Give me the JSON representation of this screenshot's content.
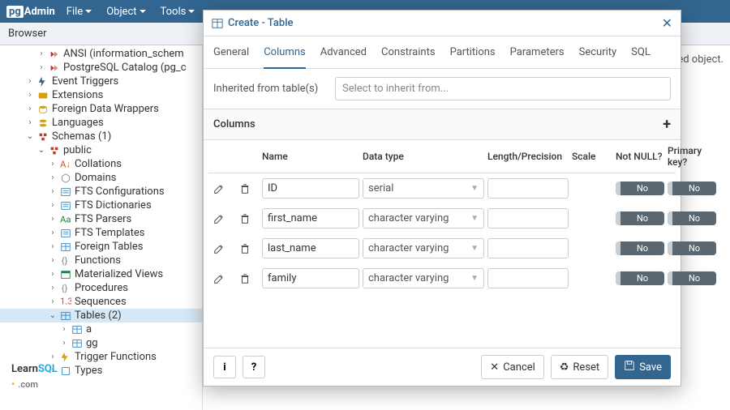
{
  "app": {
    "logo_prefix": "pg",
    "logo_rest": "Admin"
  },
  "menus": [
    "File",
    "Object",
    "Tools"
  ],
  "browser_label": "Browser",
  "content_hint": "ed object.",
  "tree": [
    {
      "indent": 3,
      "chev": ">",
      "icon": "cat",
      "color": "#c0392b",
      "label": "ANSI (information_schem"
    },
    {
      "indent": 3,
      "chev": ">",
      "icon": "cat",
      "color": "#c0392b",
      "label": "PostgreSQL Catalog (pg_c"
    },
    {
      "indent": 2,
      "chev": ">",
      "icon": "bolt",
      "color": "#326690",
      "label": "Event Triggers"
    },
    {
      "indent": 2,
      "chev": ">",
      "icon": "ext",
      "color": "#d6a20a",
      "label": "Extensions"
    },
    {
      "indent": 2,
      "chev": ">",
      "icon": "wrap",
      "color": "#d6a20a",
      "label": "Foreign Data Wrappers"
    },
    {
      "indent": 2,
      "chev": ">",
      "icon": "lang",
      "color": "#d6a20a",
      "label": "Languages"
    },
    {
      "indent": 2,
      "chev": "v",
      "icon": "schema",
      "color": "#c0392b",
      "label": "Schemas (1)"
    },
    {
      "indent": 3,
      "chev": "v",
      "icon": "schema",
      "color": "#c0392b",
      "label": "public"
    },
    {
      "indent": 4,
      "chev": ">",
      "icon": "coll",
      "color": "#c8512e",
      "label": "Collations"
    },
    {
      "indent": 4,
      "chev": ">",
      "icon": "dom",
      "color": "#7f8c8d",
      "label": "Domains"
    },
    {
      "indent": 4,
      "chev": ">",
      "icon": "fts",
      "color": "#2e86c1",
      "label": "FTS Configurations"
    },
    {
      "indent": 4,
      "chev": ">",
      "icon": "fts",
      "color": "#2e86c1",
      "label": "FTS Dictionaries"
    },
    {
      "indent": 4,
      "chev": ">",
      "icon": "ftsp",
      "color": "#1e8449",
      "label": "FTS Parsers"
    },
    {
      "indent": 4,
      "chev": ">",
      "icon": "fts",
      "color": "#2e86c1",
      "label": "FTS Templates"
    },
    {
      "indent": 4,
      "chev": ">",
      "icon": "tbl",
      "color": "#2e86c1",
      "label": "Foreign Tables"
    },
    {
      "indent": 4,
      "chev": ">",
      "icon": "fn",
      "color": "#7f8c8d",
      "label": "Functions"
    },
    {
      "indent": 4,
      "chev": ">",
      "icon": "mv",
      "color": "#1e8449",
      "label": "Materialized Views"
    },
    {
      "indent": 4,
      "chev": ">",
      "icon": "fn",
      "color": "#7f8c8d",
      "label": "Procedures"
    },
    {
      "indent": 4,
      "chev": ">",
      "icon": "seq",
      "color": "#c8512e",
      "label": "Sequences"
    },
    {
      "indent": 4,
      "chev": "v",
      "icon": "tbl",
      "color": "#2e86c1",
      "label": "Tables (2)",
      "sel": true
    },
    {
      "indent": 5,
      "chev": ">",
      "icon": "tbl",
      "color": "#2e86c1",
      "label": "a"
    },
    {
      "indent": 5,
      "chev": ">",
      "icon": "tbl",
      "color": "#2e86c1",
      "label": "gg"
    },
    {
      "indent": 4,
      "chev": ">",
      "icon": "trig",
      "color": "#d6a20a",
      "label": "Trigger Functions"
    },
    {
      "indent": 4,
      "chev": ">",
      "icon": "type",
      "color": "#2e86c1",
      "label": "Types"
    }
  ],
  "dialog": {
    "title": "Create - Table",
    "tabs": [
      "General",
      "Columns",
      "Advanced",
      "Constraints",
      "Partitions",
      "Parameters",
      "Security",
      "SQL"
    ],
    "active_tab": 1,
    "inherit_label": "Inherited from table(s)",
    "inherit_placeholder": "Select to inherit from...",
    "columns_label": "Columns",
    "headers": [
      "Name",
      "Data type",
      "Length/Precision",
      "Scale",
      "Not NULL?",
      "Primary key?"
    ],
    "rows": [
      {
        "name": "ID",
        "type": "serial",
        "nn": "No",
        "pk": "No"
      },
      {
        "name": "first_name",
        "type": "character varying",
        "nn": "No",
        "pk": "No"
      },
      {
        "name": "last_name",
        "type": "character varying",
        "nn": "No",
        "pk": "No"
      },
      {
        "name": "family",
        "type": "character varying",
        "nn": "No",
        "pk": "No"
      }
    ],
    "footer": {
      "info": "i",
      "help": "?",
      "cancel": "Cancel",
      "reset": "Reset",
      "save": "Save"
    }
  },
  "learn": {
    "a": "Learn",
    "b": "SQL",
    "c": ".com"
  }
}
